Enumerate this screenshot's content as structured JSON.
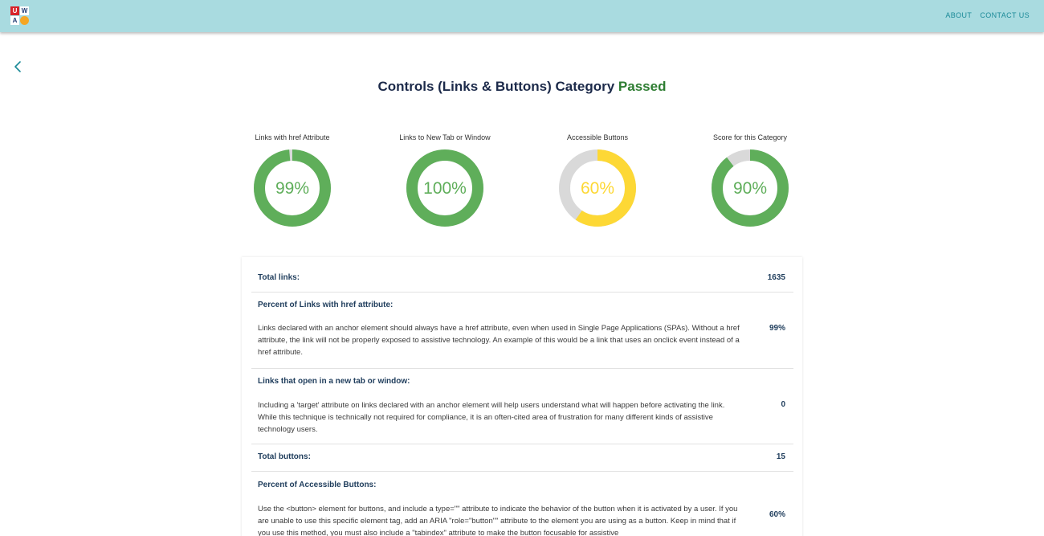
{
  "header": {
    "logo_letters": [
      "U",
      "W",
      "A",
      "●"
    ],
    "nav": [
      "ABOUT",
      "CONTACT US"
    ]
  },
  "title": {
    "main": "Controls (Links & Buttons) Category",
    "status": "Passed"
  },
  "gauges": [
    {
      "label": "Links with href Attribute",
      "value": 99,
      "display": "99%",
      "color": "#5fae5a"
    },
    {
      "label": "Links to New Tab or Window",
      "value": 100,
      "display": "100%",
      "color": "#5fae5a"
    },
    {
      "label": "Accessible Buttons",
      "value": 60,
      "display": "60%",
      "color": "#fdd835"
    },
    {
      "label": "Score for this Category",
      "value": 90,
      "display": "90%",
      "color": "#5fae5a"
    }
  ],
  "details": {
    "total_links": {
      "label": "Total links:",
      "value": "1635"
    },
    "href_percent": {
      "label": "Percent of Links with href attribute:",
      "desc": "Links declared with an anchor element should always have a href attribute, even when used in Single Page Applications (SPAs). Without a href attribute, the link will not be properly exposed to assistive technology. An example of this would be a link that uses an onclick event instead of a href attribute.",
      "value": "99%"
    },
    "new_tab": {
      "label": "Links that open in a new tab or window:",
      "desc": "Including a 'target' attribute on links declared with an anchor element will help users understand what will happen before activating the link. While this technique is technically not required for compliance, it is an often-cited area of frustration for many different kinds of assistive technology users.",
      "value": "0"
    },
    "total_buttons": {
      "label": "Total buttons:",
      "value": "15"
    },
    "accessible_buttons": {
      "label": "Percent of Accessible Buttons:",
      "desc": "Use the <button> element for buttons, and include a type=\"\" attribute to indicate the behavior of the button when it is activated by a user. If you are unable to use this specific element tag, add an ARIA \"role=\"button\"\" attribute to the element you are using as a button. Keep in mind that if you use this method, you must also include a \"tabindex\" attribute to make the button focusable for assistive",
      "value": "60%"
    }
  },
  "colors": {
    "header_bg": "#a9dbe0",
    "nav_text": "#1b8a98",
    "passed": "#2e7d32",
    "gauge_green": "#5fae5a",
    "gauge_yellow": "#fdd835",
    "gauge_track": "#d9d9d9"
  }
}
